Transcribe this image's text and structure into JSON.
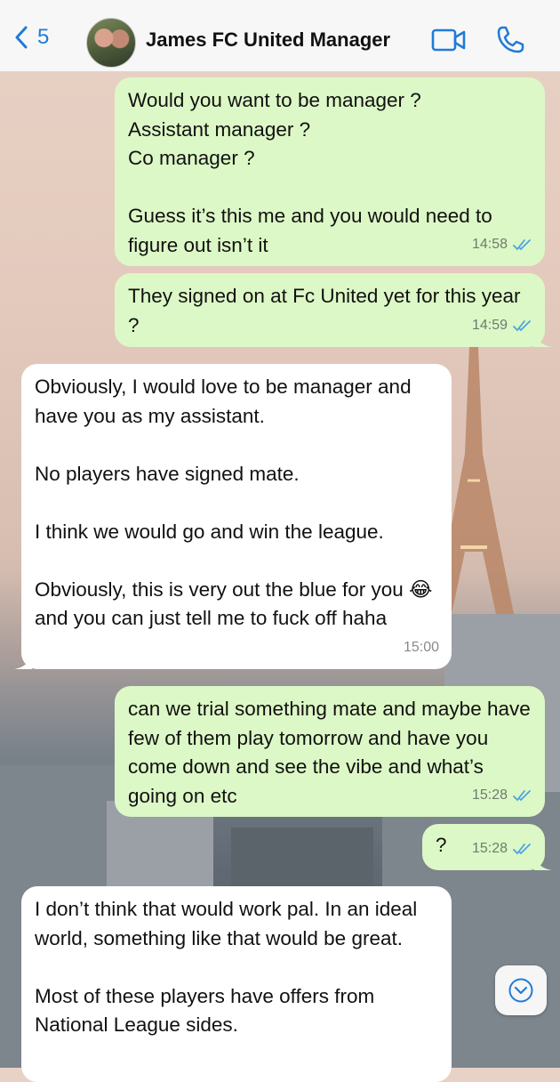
{
  "header": {
    "back_count": "5",
    "contact_name": "James FC United Manager"
  },
  "messages": [
    {
      "direction": "outgoing",
      "text": "Would you want to be manager ?\nAssistant manager ?\nCo manager ?\n\nGuess it’s this me and you would need to figure out isn’t it",
      "time": "14:58",
      "status": "read"
    },
    {
      "direction": "outgoing",
      "text": "They signed on at Fc United yet for this year ?",
      "time": "14:59",
      "status": "read"
    },
    {
      "direction": "incoming",
      "text": "Obviously, I would love to be manager and have you as my assistant.\n\nNo players have signed mate.\n\nI think we would go and win the league.\n\nObviously, this is very out the blue for you 😂 and you can just tell me to fuck off haha",
      "time": "15:00"
    },
    {
      "direction": "outgoing",
      "text": "can we trial something mate and maybe have few of them play tomorrow and have you come down and see the vibe and what’s going on etc",
      "time": "15:28",
      "status": "read"
    },
    {
      "direction": "outgoing",
      "text": "?",
      "time": "15:28",
      "status": "read"
    },
    {
      "direction": "incoming",
      "text": "I don’t think that would work pal. In an ideal world, something like that would be great.\n\nMost of these players have offers from National League sides.",
      "time": ""
    }
  ],
  "colors": {
    "outgoing_bubble": "#dcf8c6",
    "incoming_bubble": "#ffffff",
    "accent": "#1f7bd8",
    "read_ticks": "#4fa3e0"
  },
  "icons": {
    "back": "chevron-left-icon",
    "video": "video-camera-icon",
    "call": "phone-icon",
    "scroll": "chevron-down-circle-icon"
  }
}
